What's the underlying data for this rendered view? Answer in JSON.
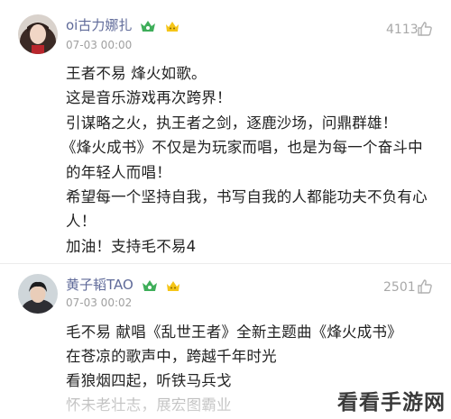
{
  "comments": [
    {
      "username": "oi古力娜扎",
      "time": "07-03 00:00",
      "likes": "4113",
      "badge_icons": [
        "vip-crown-icon",
        "smile-badge-icon"
      ],
      "lines": [
        "王者不易 烽火如歌。",
        "这是音乐游戏再次跨界！",
        "引谋略之火，执王者之剑，逐鹿沙场，问鼎群雄！",
        "《烽火成书》不仅是为玩家而唱，也是为每一个奋斗中",
        "的年轻人而唱！",
        "希望每一个坚持自我，书写自我的人都能功夫不负有心",
        "人！",
        "加油！支持毛不易4"
      ]
    },
    {
      "username": "黄子韬TAO",
      "time": "07-03 00:02",
      "likes": "2501",
      "badge_icons": [
        "vip-crown-icon",
        "smile-badge-icon"
      ],
      "lines": [
        "毛不易 献唱《乱世王者》全新主题曲《烽火成书》",
        "在苍凉的歌声中，跨越千年时光",
        "看狼烟四起，听铁马兵戈",
        "怀未老壮志，展宏图霸业"
      ]
    }
  ],
  "watermark": "看看手游网",
  "colors": {
    "username": "#5f6a99",
    "meta": "#a0a0a0",
    "text": "#222222",
    "badge_green": "#3fae5a",
    "badge_yellow": "#f5c518"
  }
}
